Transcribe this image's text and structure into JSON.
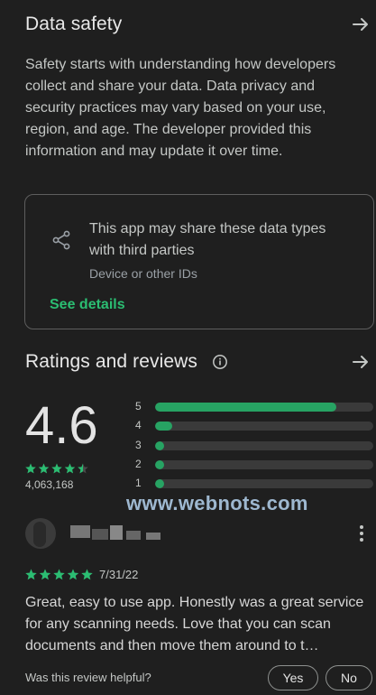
{
  "data_safety": {
    "title": "Data safety",
    "description": "Safety starts with understanding how developers collect and share your data. Data privacy and security practices may vary based on your use, region, and age. The developer provided this information and may update it over time.",
    "card": {
      "heading": "This app may share these data types with third parties",
      "subtext": "Device or other IDs",
      "link_label": "See details"
    }
  },
  "ratings": {
    "title": "Ratings and reviews",
    "score": "4.6",
    "review_count": "4,063,168",
    "stars_value": 4.5,
    "bars": [
      {
        "label": "5",
        "fraction": 0.83
      },
      {
        "label": "4",
        "fraction": 0.08
      },
      {
        "label": "3",
        "fraction": 0.04
      },
      {
        "label": "2",
        "fraction": 0.04
      },
      {
        "label": "1",
        "fraction": 0.04
      }
    ],
    "accent_color": "#2bbd72"
  },
  "watermark": "www.webnots.com",
  "review": {
    "stars_value": 5,
    "date": "7/31/22",
    "text": "Great, easy to use app. Honestly was a great service for any scanning needs. Love that you can scan documents and then move them around to t…",
    "helpful_prompt": "Was this review helpful?",
    "yes_label": "Yes",
    "no_label": "No"
  }
}
